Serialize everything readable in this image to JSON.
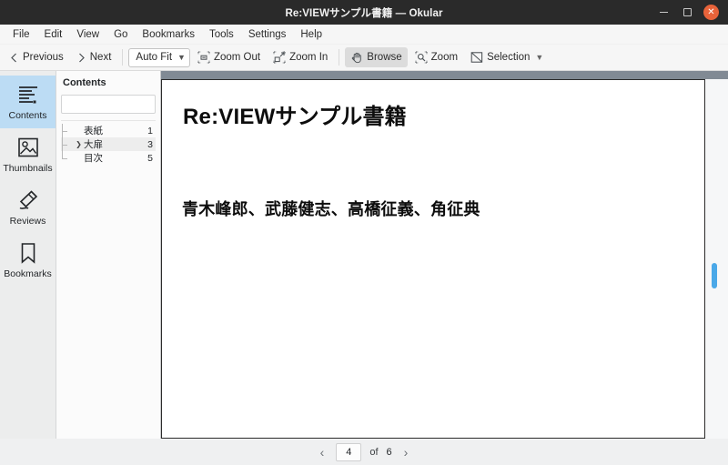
{
  "window": {
    "title": "Re:VIEWサンプル書籍 — Okular",
    "minimize_label": "",
    "maximize_label": "",
    "close_label": "✕"
  },
  "menubar": {
    "items": [
      {
        "label": "File"
      },
      {
        "label": "Edit"
      },
      {
        "label": "View"
      },
      {
        "label": "Go"
      },
      {
        "label": "Bookmarks"
      },
      {
        "label": "Tools"
      },
      {
        "label": "Settings"
      },
      {
        "label": "Help"
      }
    ]
  },
  "toolbar": {
    "previous_label": "Previous",
    "next_label": "Next",
    "zoom_mode_value": "Auto Fit",
    "zoom_out_label": "Zoom Out",
    "zoom_in_label": "Zoom In",
    "browse_label": "Browse",
    "zoom_label": "Zoom",
    "selection_label": "Selection"
  },
  "sidebar": {
    "items": [
      {
        "label": "Contents",
        "icon": "contents-icon",
        "selected": true
      },
      {
        "label": "Thumbnails",
        "icon": "thumbnails-icon",
        "selected": false
      },
      {
        "label": "Reviews",
        "icon": "reviews-icon",
        "selected": false
      },
      {
        "label": "Bookmarks",
        "icon": "bookmarks-icon",
        "selected": false
      }
    ]
  },
  "contents_panel": {
    "title": "Contents",
    "search_value": "",
    "search_placeholder": "",
    "toc": [
      {
        "label": "表紙",
        "page": "1",
        "selected": false,
        "expandable": false
      },
      {
        "label": "大扉",
        "page": "3",
        "selected": true,
        "expandable": true
      },
      {
        "label": "目次",
        "page": "5",
        "selected": false,
        "expandable": false
      }
    ]
  },
  "document": {
    "title": "Re:VIEWサンプル書籍",
    "authors": "青木峰郎、武藤健志、高橋征義、角征典"
  },
  "statusbar": {
    "prev_glyph": "‹",
    "next_glyph": "›",
    "current_page": "4",
    "of_label": "of",
    "total_pages": "6"
  },
  "colors": {
    "titlebar_bg": "#2a2a2a",
    "close_button": "#e8633a",
    "sidebar_selected": "#bcdcf4",
    "scrollbar_thumb": "#4aa8e8",
    "toolbar_active": "#dcdcdc"
  }
}
